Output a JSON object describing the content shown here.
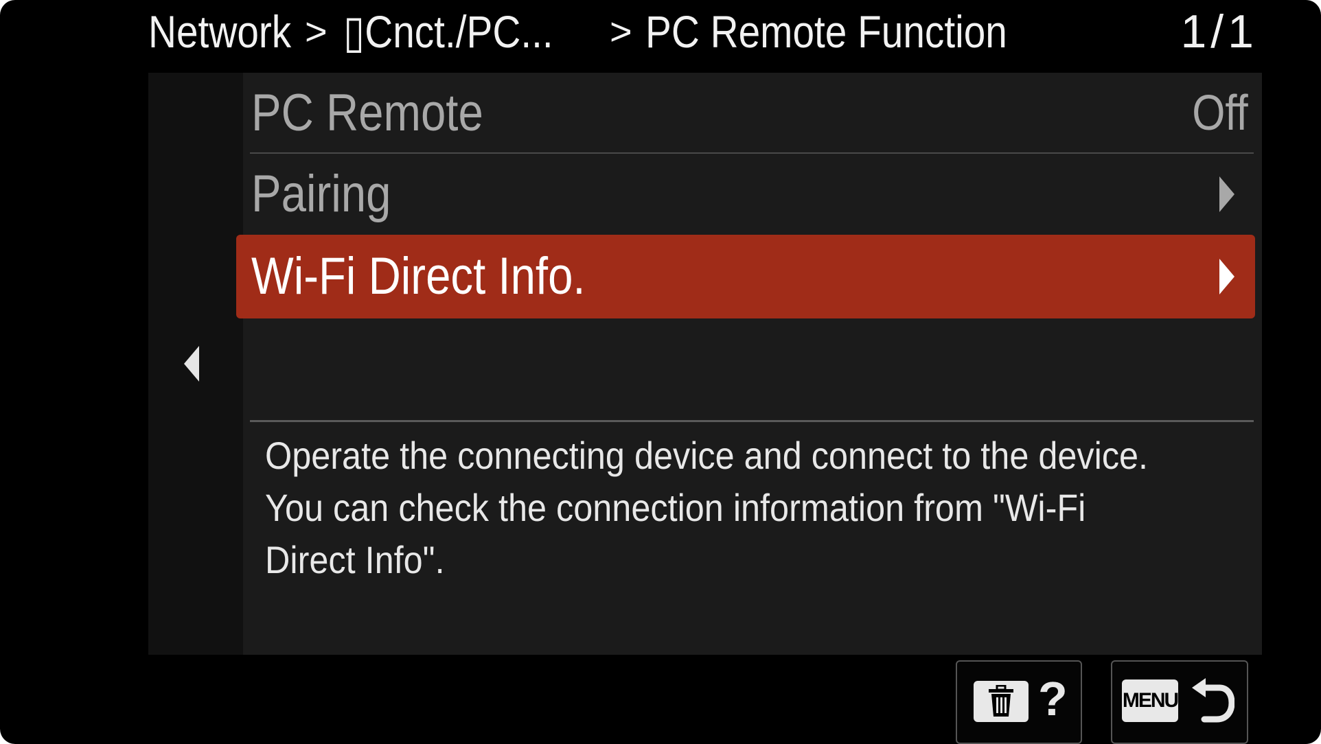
{
  "header": {
    "breadcrumb": [
      "Network",
      "Cnct./PC...",
      "PC Remote Function"
    ],
    "separator": ">",
    "page_indicator": "1/1",
    "device_glyph": "▯"
  },
  "menu": {
    "items": [
      {
        "label": "PC Remote",
        "value": "Off"
      },
      {
        "label": "Pairing",
        "value": ""
      },
      {
        "label": "Wi-Fi Direct Info.",
        "value": "",
        "selected": true
      }
    ]
  },
  "description": {
    "lines": [
      "Operate the connecting device and connect to the device.",
      "You can check the connection information from \"Wi-Fi",
      "Direct Info\"."
    ]
  },
  "footer": {
    "help_label": "?",
    "menu_label": "MENU"
  },
  "colors": {
    "selected": "#a02c18",
    "panel": "#1b1b1b",
    "background": "#000000"
  },
  "icons": [
    "left-arrow-icon",
    "right-arrow-icon",
    "trash-icon",
    "help-icon",
    "return-icon"
  ]
}
